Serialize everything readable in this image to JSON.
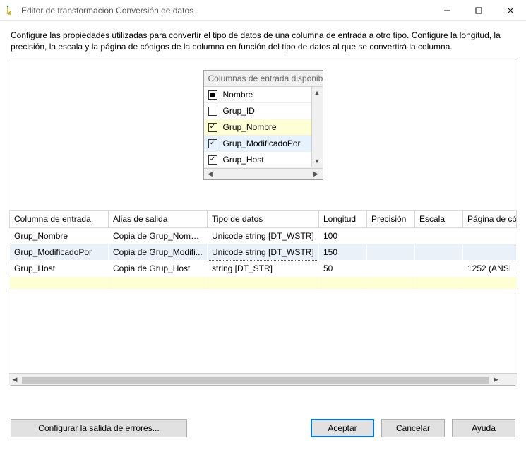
{
  "window": {
    "title": "Editor de transformación Conversión de datos"
  },
  "description": "Configure las propiedades utilizadas para convertir el tipo de datos de una columna de entrada a otro tipo. Configure la longitud, la precisión, la escala y la página de códigos de la columna en función del tipo de datos al que se convertirá la columna.",
  "available_columns": {
    "header": "Columnas de entrada disponibl...",
    "items": [
      {
        "label": "Nombre",
        "state": "filled",
        "highlight": false
      },
      {
        "label": "Grup_ID",
        "state": "empty",
        "highlight": false
      },
      {
        "label": "Grup_Nombre",
        "state": "checked",
        "highlight": true
      },
      {
        "label": "Grup_ModificadoPor",
        "state": "checked",
        "highlight": false,
        "selected": true
      },
      {
        "label": "Grup_Host",
        "state": "checked",
        "highlight": false
      }
    ]
  },
  "grid": {
    "headers": {
      "entrada": "Columna de entrada",
      "alias": "Alias de salida",
      "tipo": "Tipo de datos",
      "longitud": "Longitud",
      "precision": "Precisión",
      "escala": "Escala",
      "codepage": "Página de có"
    },
    "rows": [
      {
        "entrada": "Grup_Nombre",
        "alias": "Copia de Grup_Nombre",
        "tipo": "Unicode string [DT_WSTR]",
        "longitud": "100",
        "precision": "",
        "escala": "",
        "codepage": ""
      },
      {
        "entrada": "Grup_ModificadoPor",
        "alias": "Copia de Grup_Modifi...",
        "tipo": "Unicode string [DT_WSTR]",
        "longitud": "150",
        "precision": "",
        "escala": "",
        "codepage": "",
        "selected": true
      },
      {
        "entrada": "Grup_Host",
        "alias": "Copia de Grup_Host",
        "tipo": "string [DT_STR]",
        "longitud": "50",
        "precision": "",
        "escala": "",
        "codepage": "1252  (ANSI"
      }
    ]
  },
  "buttons": {
    "configure_error_output": "Configurar la salida de errores...",
    "accept": "Aceptar",
    "cancel": "Cancelar",
    "help": "Ayuda"
  }
}
